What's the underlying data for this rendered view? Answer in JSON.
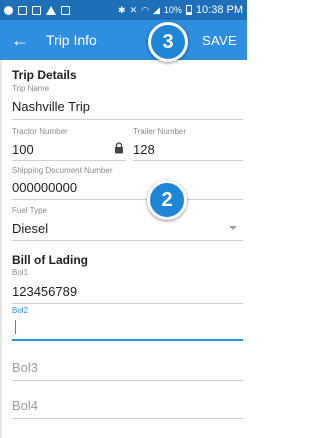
{
  "status_bar": {
    "battery_pct": "10%",
    "time": "10:38 PM",
    "color": "#1e6fb8"
  },
  "app_bar": {
    "title": "Trip Info",
    "save_label": "SAVE",
    "back_icon": "arrow-left-icon",
    "color": "#2e8ee0"
  },
  "badges": {
    "step3": "3",
    "step2": "2"
  },
  "trip_details": {
    "section_title": "Trip Details",
    "trip_name_label": "Trip Name",
    "trip_name_value": "Nashville Trip",
    "tractor_label": "Tractor Number",
    "tractor_value": "100",
    "trailer_label": "Trailer Number",
    "trailer_value": "128",
    "shipping_label": "Shipping Document Number",
    "shipping_value": "000000000",
    "fuel_label": "Fuel Type",
    "fuel_value": "Diesel"
  },
  "bill_of_lading": {
    "section_title": "Bill of Lading",
    "bol1_label": "Bol1",
    "bol1_value": "123456789",
    "bol2_label": "Bol2",
    "bol3_placeholder": "Bol3",
    "bol4_placeholder": "Bol4"
  }
}
